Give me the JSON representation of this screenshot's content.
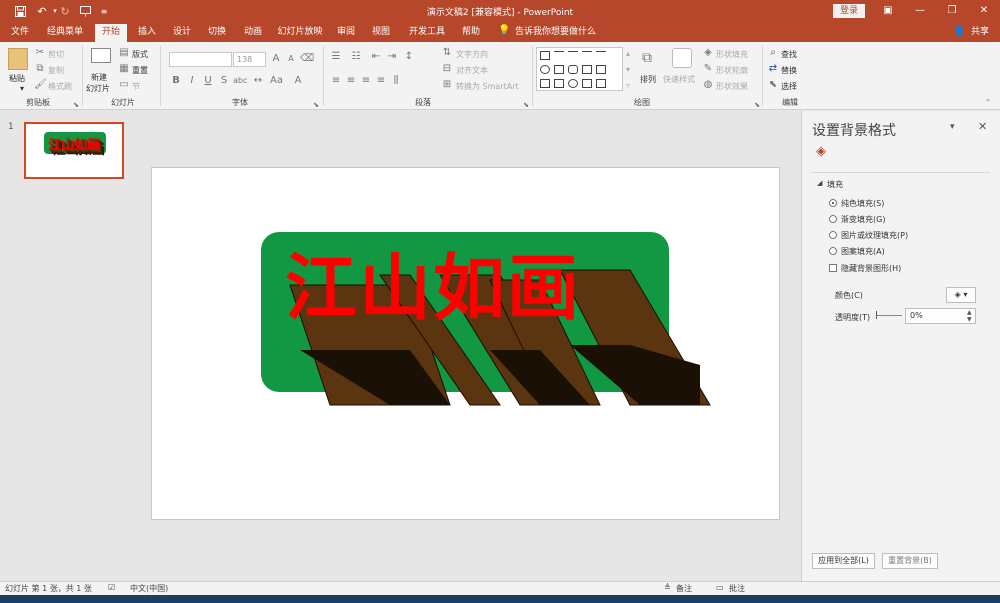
{
  "titlebar": {
    "title": "演示文稿2 [兼容模式] - PowerPoint",
    "login": "登录",
    "icons": [
      "save-icon",
      "undo-icon",
      "redo-icon",
      "start-from-beginning-icon",
      "customize-icon"
    ]
  },
  "tabs": [
    "文件",
    "经典菜单",
    "开始",
    "插入",
    "设计",
    "切换",
    "动画",
    "幻灯片放映",
    "审阅",
    "视图",
    "开发工具",
    "帮助"
  ],
  "tell_me": "告诉我你想要做什么",
  "share": "共享",
  "ribbon": {
    "clipboard": {
      "label": "剪贴板",
      "paste": "粘贴",
      "cut": "剪切",
      "copy": "复制",
      "format_painter": "格式刷"
    },
    "slides": {
      "label": "幻灯片",
      "new_slide": "新建",
      "new_slide2": "幻灯片",
      "layout": "版式",
      "reset": "重置",
      "section": "节"
    },
    "font": {
      "label": "字体",
      "size": "138"
    },
    "paragraph": {
      "label": "段落",
      "text_direction": "文字方向",
      "align_text": "对齐文本",
      "smartart": "转换为 SmartArt"
    },
    "drawing": {
      "label": "绘图",
      "arrange": "排列",
      "quick_styles": "快速样式",
      "shape_fill": "形状填充",
      "shape_outline": "形状轮廓",
      "shape_effects": "形状效果"
    },
    "editing": {
      "label": "编辑",
      "find": "查找",
      "replace": "替换",
      "select": "选择"
    }
  },
  "thumbnail": {
    "number": "1"
  },
  "slide": {
    "text": "江山如画",
    "bg_color": "#129842",
    "text_color": "#ff0000",
    "extrude_color": "#5a3510"
  },
  "panel": {
    "title": "设置背景格式",
    "section": "填充",
    "options": [
      "纯色填充(S)",
      "渐变填充(G)",
      "图片或纹理填充(P)",
      "图案填充(A)"
    ],
    "hide_bg": "隐藏背景图形(H)",
    "color_label": "颜色(C)",
    "transparency_label": "透明度(T)",
    "transparency_value": "0%",
    "apply_all": "应用到全部(L)",
    "reset_bg": "重置背景(B)"
  },
  "status": {
    "slide_info": "幻灯片 第 1 张，共 1 张",
    "language": "中文(中国)",
    "notes": "备注",
    "comments": "批注"
  }
}
